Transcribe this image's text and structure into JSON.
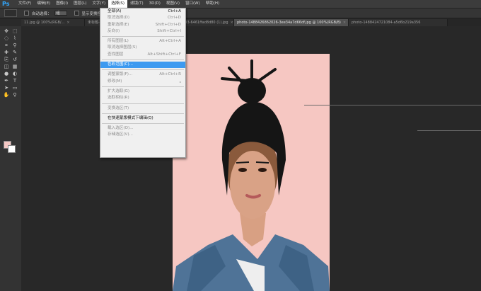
{
  "app": {
    "logo": "Ps"
  },
  "menubar": [
    "文件(F)",
    "编辑(E)",
    "图像(I)",
    "图层(L)",
    "文字(Y)",
    "选择(S)",
    "滤镜(T)",
    "3D(D)",
    "视图(V)",
    "窗口(W)",
    "帮助(H)"
  ],
  "options": {
    "auto_select_label": "自动选择：",
    "auto_select_value": "组",
    "show_transform_label": "显示变换控件"
  },
  "tabs": [
    {
      "label": "11.jpg @ 100%(RGB/...",
      "active": false
    },
    {
      "label": "未标题-1 @ 66.7%(RGB/8#)",
      "active": false
    },
    {
      "label": "photo-1438761681033-6461ffad8d80 (1).jpg",
      "active": false
    },
    {
      "label": "photo-1488426862026-3ee34a7d66df.jpg @ 100%(RGB/8)",
      "active": true
    },
    {
      "label": "photo-1488424721084-a5d6b219a356",
      "active": false
    }
  ],
  "tab_close_glyph": "×",
  "select_menu": [
    {
      "type": "item",
      "label": "全部(A)",
      "shortcut": "Ctrl+A",
      "disabled": false
    },
    {
      "type": "item",
      "label": "取消选择(D)",
      "shortcut": "Ctrl+D",
      "disabled": true
    },
    {
      "type": "item",
      "label": "重新选择(E)",
      "shortcut": "Shift+Ctrl+D",
      "disabled": true
    },
    {
      "type": "item",
      "label": "反向(I)",
      "shortcut": "Shift+Ctrl+I",
      "disabled": true
    },
    {
      "type": "sep"
    },
    {
      "type": "item",
      "label": "所有图层(L)",
      "shortcut": "Alt+Ctrl+A",
      "disabled": true
    },
    {
      "type": "item",
      "label": "取消选择图层(S)",
      "shortcut": "",
      "disabled": true
    },
    {
      "type": "item",
      "label": "查找图层",
      "shortcut": "Alt+Shift+Ctrl+F",
      "disabled": true
    },
    {
      "type": "sep"
    },
    {
      "type": "item",
      "label": "色彩范围(C)...",
      "shortcut": "",
      "disabled": false,
      "highlight": true
    },
    {
      "type": "sep"
    },
    {
      "type": "item",
      "label": "调整蒙版(F)...",
      "shortcut": "Alt+Ctrl+R",
      "disabled": true
    },
    {
      "type": "item",
      "label": "修改(M)",
      "shortcut": "",
      "disabled": true,
      "submenu": true
    },
    {
      "type": "sep"
    },
    {
      "type": "item",
      "label": "扩大选取(G)",
      "shortcut": "",
      "disabled": true
    },
    {
      "type": "item",
      "label": "选取相似(R)",
      "shortcut": "",
      "disabled": true
    },
    {
      "type": "sep"
    },
    {
      "type": "item",
      "label": "变换选区(T)",
      "shortcut": "",
      "disabled": true
    },
    {
      "type": "sep"
    },
    {
      "type": "item",
      "label": "在快速蒙版模式下编辑(Q)",
      "shortcut": "",
      "disabled": false
    },
    {
      "type": "sep"
    },
    {
      "type": "item",
      "label": "载入选区(O)...",
      "shortcut": "",
      "disabled": true
    },
    {
      "type": "item",
      "label": "存储选区(V)...",
      "shortcut": "",
      "disabled": true
    }
  ],
  "tool_icons": [
    "move-icon",
    "marquee-icon",
    "lasso-icon",
    "quick-select-icon",
    "crop-icon",
    "eyedropper-icon",
    "healing-icon",
    "brush-icon",
    "stamp-icon",
    "history-brush-icon",
    "eraser-icon",
    "gradient-icon",
    "blur-icon",
    "dodge-icon",
    "pen-icon",
    "text-icon",
    "path-select-icon",
    "shape-icon",
    "hand-icon",
    "zoom-icon"
  ],
  "colors": {
    "foreground": "#f5c8c4",
    "background": "#ffffff",
    "menu_highlight": "#3d9af0",
    "photo_bg": "#f6c7c2"
  }
}
